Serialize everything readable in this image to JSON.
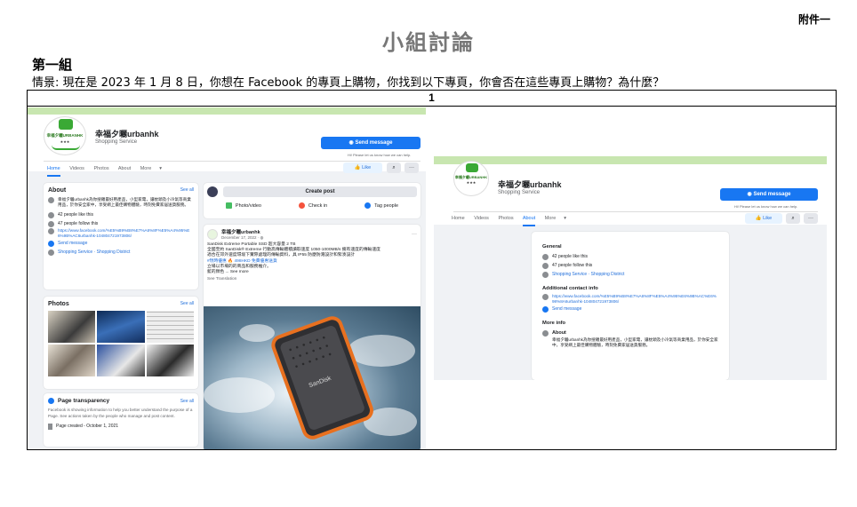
{
  "annex": "附件一",
  "title": "小組討論",
  "group": "第一組",
  "scenario": "情景: 現在是 2023 年 1 月 8 日，你想在 Facebook 的專頁上購物，你找到以下專頁，你會否在這些專頁上購物？為什麼？",
  "frame_number": "1",
  "page_name": "幸福夕曬urbanhk",
  "page_category": "Shopping Service",
  "logo_text": "幸福夕曬URBANHK",
  "send_message": "Send message",
  "send_message_hint": "Hi! Please let us know how we can help.",
  "like_button": "Like",
  "tabs": [
    "Home",
    "Videos",
    "Photos",
    "About",
    "More"
  ],
  "left": {
    "active_tab": "Home",
    "about_title": "About",
    "see_all": "See all",
    "about_desc": "幸福夕曬urbanhk為你搜羅最好用產品，小型家電，讓枕頭及小冷氣等商業用品，於你安全家中，享受網上最佳購物體驗，時刻免費家居送貨服務。",
    "likes": "42 people like this",
    "follows": "47 people follow this",
    "url": "https://www.facebook.com/%E5%B9%B8%E7%A6%8F%E5%A4%95%E6%9B%AC6urbanhk-104804721973806/",
    "send_msg_link": "Send message",
    "category_link": "Shopping Service · Shopping District",
    "photos_title": "Photos",
    "transparency_title": "Page transparency",
    "transparency_text": "Facebook is showing information to help you better understand the purpose of a Page. See actions taken by the people who manage and post content.",
    "page_created": "Page created - October 1, 2021",
    "create_post": "Create post",
    "photo_video": "Photo/video",
    "check_in": "Check in",
    "tag_people": "Tag people",
    "post_author": "幸福夕曬urbanhk",
    "post_date": "December 17, 2022 · ",
    "post_line1": "SanDisk Extreme Portable SSD 超大容量 2 TB",
    "post_line2": "全國至約 SanDisk® Extreme 行動高傳輸體積讀取速度 1050-1000MB/s 擁有速度的傳輸速度",
    "post_line3": "適合在郊外速度環境下實際處理的傳輸資料，具 IP55 防塵防濺設計和緊湊設計",
    "post_line4": "#現時優惠 🔥 498HKD 免費優惠送貨",
    "post_line5": "立場以市場的的商品和服務推介。",
    "post_line6": "藍的顏色 ... See more",
    "see_translation": "See Translation",
    "product_brand": "SanDisk"
  },
  "right": {
    "active_tab": "About",
    "general_title": "General",
    "likes": "42 people like this",
    "follows": "47 people follow this",
    "category_link": "Shopping Service · Shopping District",
    "contact_title": "Additional contact info",
    "url": "https://www.facebook.com/%E5%B9%B8%E7%A6%8F%E5%A4%95%E6%9B%AC%E6%98%8A6urbanhk-104804721973806/",
    "send_msg_link": "Send message",
    "more_info_title": "More info",
    "about_label": "About",
    "about_desc": "幸福夕曬urbanhk為你搜羅最好用產品，小型家電，讓枕頭及小冷氣等商業用品，於你安全家中，享受網上最佳購物體驗，時刻免費家居送貨服務。"
  },
  "colors": {
    "fb_blue": "#1877f2",
    "cover_green": "#c8e6b0",
    "fb_bg": "#f0f2f5",
    "title_grey": "#777777"
  }
}
